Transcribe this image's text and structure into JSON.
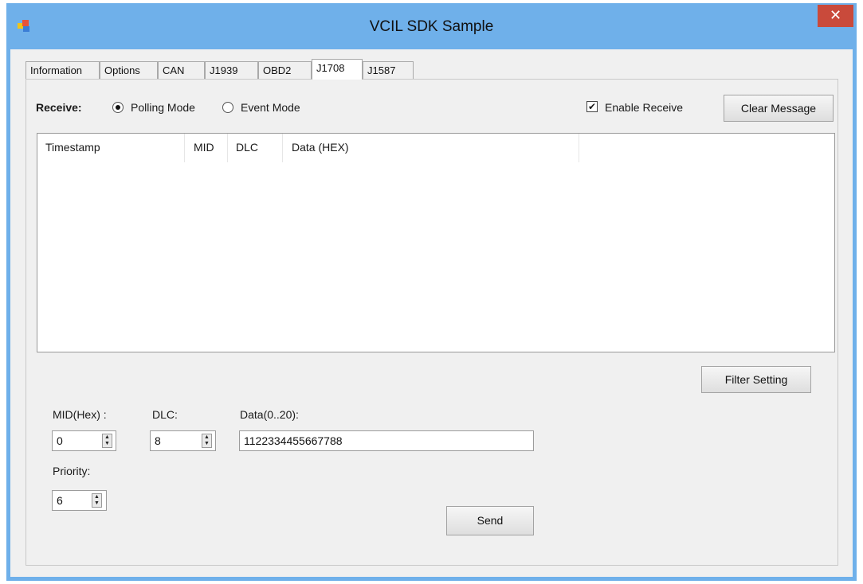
{
  "window": {
    "title": "VCIL SDK Sample",
    "close_glyph": "✕"
  },
  "tabs": [
    "Information",
    "Options",
    "CAN",
    "J1939",
    "OBD2",
    "J1708",
    "J1587"
  ],
  "active_tab": "J1708",
  "receive": {
    "label": "Receive:",
    "polling_label": "Polling Mode",
    "event_label": "Event Mode",
    "selected_mode": "Polling Mode",
    "enable_label": "Enable Receive",
    "enable_checked": true,
    "check_glyph": "✔",
    "clear_label": "Clear Message"
  },
  "list": {
    "columns": [
      "Timestamp",
      "MID",
      "DLC",
      "Data (HEX)"
    ]
  },
  "filter_label": "Filter Setting",
  "form": {
    "mid_label": "MID(Hex) :",
    "mid_value": "0",
    "dlc_label": "DLC:",
    "dlc_value": "8",
    "data_label": "Data(0..20):",
    "data_value": "1122334455667788",
    "priority_label": "Priority:",
    "priority_value": "6",
    "send_label": "Send",
    "spin_up": "▲",
    "spin_down": "▼"
  }
}
